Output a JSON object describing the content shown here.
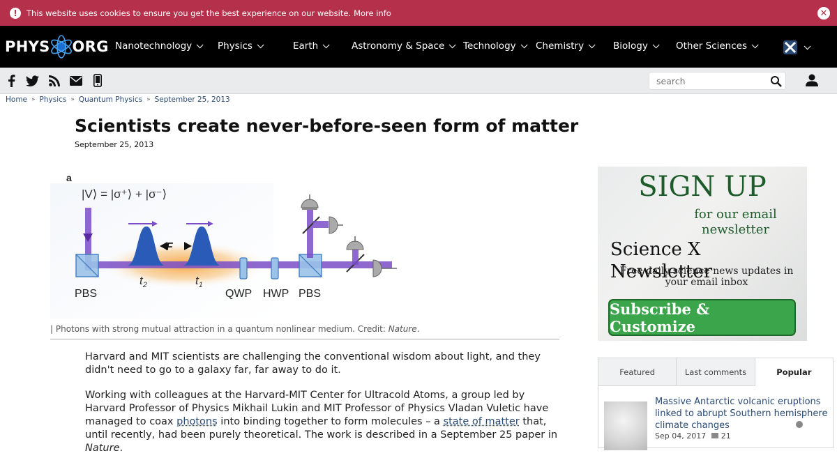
{
  "cookie": {
    "message": "This website uses cookies to ensure you get the best experience on our website.",
    "more_label": "More info",
    "close_glyph": "✕"
  },
  "logo": {
    "left": "PHYS",
    "right": "ORG"
  },
  "nav": {
    "items": [
      "Nanotechnology",
      "Physics",
      "Earth",
      "Astronomy & Space",
      "Technology",
      "Chemistry",
      "Biology",
      "Other Sciences"
    ]
  },
  "toolbar": {
    "search_placeholder": "search"
  },
  "breadcrumb": [
    "Home",
    "Physics",
    "Quantum Physics",
    "September 25, 2013"
  ],
  "article": {
    "title": "Scientists create never-before-seen form of matter",
    "date": "September 25, 2013",
    "caption_prefix": "| Photons with strong mutual attraction in a quantum nonlinear medium. Credit: ",
    "caption_credit": "Nature",
    "caption_suffix": ".",
    "p1": "Harvard and MIT scientists are challenging the conventional wisdom about light, and they didn't need to go to a galaxy far, far away to do it.",
    "p2_a": "Working with colleagues at the Harvard-MIT Center for Ultracold Atoms, a group led by Harvard Professor of Physics Mikhail Lukin and MIT Professor of Physics Vladan Vuletic have managed to coax ",
    "p2_link1": "photons",
    "p2_b": " into binding together to form molecules – a ",
    "p2_link2": "state of matter",
    "p2_c": " that, until recently, had been purely theoretical. The work is described in a September 25 paper in ",
    "p2_journal": "Nature",
    "p2_d": "."
  },
  "figure": {
    "panel_label": "a",
    "formula": "|V⟩ = |σ⁺⟩ + |σ⁻⟩",
    "force": "F",
    "t2": "t",
    "t2_sub": "2",
    "t1": "t",
    "t1_sub": "1",
    "labels": [
      "PBS",
      "QWP",
      "HWP",
      "PBS"
    ]
  },
  "ad": {
    "signup": "SIGN UP",
    "for_email": "for our email newsletter",
    "sx_newsletter": "Science X Newsletter",
    "free": "Free daily science news updates in your email inbox",
    "subscribe": "Subscribe & Customize"
  },
  "widget": {
    "tabs": [
      "Featured",
      "Last comments",
      "Popular"
    ],
    "item": {
      "headline": "Massive Antarctic volcanic eruptions linked to abrupt Southern hemisphere climate changes",
      "date": "Sep 04, 2017",
      "comments": "21"
    }
  },
  "colors": {
    "cookie_bg": "#b5304a",
    "nav_bg": "#000000",
    "toolbar_bg": "#e9ebed",
    "link": "#2a4a74",
    "ad_green": "#1e5b2a",
    "subscribe_bg": "#3aa54a"
  }
}
